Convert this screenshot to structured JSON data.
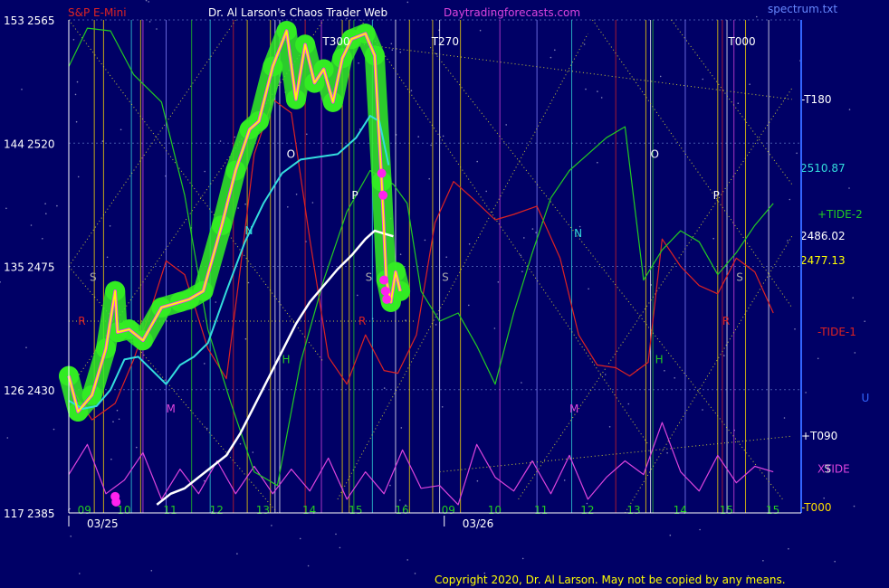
{
  "header": {
    "instrument": "S&P E-Mini",
    "title": "Dr. Al Larson's Chaos Trader Web",
    "site": "Daytradingforecasts.com",
    "spectrum": "spectrum.txt"
  },
  "copyright": "Copyright 2020, Dr. Al Larson. May not be copied by any means.",
  "colors": {
    "background": "#000066",
    "price": "#ffff00",
    "price_hl": "#ff33ff",
    "glow": "#33ee22",
    "ema_short": "#33dddd",
    "ema_long": "#ffffff",
    "tide_plus": "#22cc22",
    "tide_minus": "#dd2222",
    "xtide": "#dd44dd",
    "grid": "#555599"
  },
  "chart_data": {
    "type": "line",
    "title": "S&P E-Mini",
    "ylim": [
      2385,
      2565
    ],
    "y_ticks": [
      {
        "left": "153",
        "value": 2565
      },
      {
        "left": "144",
        "value": 2520
      },
      {
        "left": "135",
        "value": 2475
      },
      {
        "left": "126",
        "value": 2430
      },
      {
        "left": "117",
        "value": 2385
      }
    ],
    "x_hour_ticks": [
      {
        "label": "09",
        "t": 0.15
      },
      {
        "label": "10",
        "t": 1.0
      },
      {
        "label": "11",
        "t": 2.0
      },
      {
        "label": "12",
        "t": 3.0
      },
      {
        "label": "13",
        "t": 4.0
      },
      {
        "label": "14",
        "t": 5.0
      },
      {
        "label": "15",
        "t": 6.0
      },
      {
        "label": "16",
        "t": 7.0
      },
      {
        "label": "09",
        "t": 8.0
      },
      {
        "label": "10",
        "t": 9.0
      },
      {
        "label": "11",
        "t": 10.0
      },
      {
        "label": "12",
        "t": 11.0
      },
      {
        "label": "13",
        "t": 12.0
      },
      {
        "label": "14",
        "t": 13.0
      },
      {
        "label": "15",
        "t": 14.0
      },
      {
        "label": "15",
        "t": 15.0
      }
    ],
    "x_dates": [
      {
        "label": "03/25",
        "t": 0.0
      },
      {
        "label": "03/26",
        "t": 8.1
      }
    ],
    "series": [
      {
        "key": "price",
        "x": [
          0,
          0.2,
          0.5,
          0.8,
          1.0,
          1.05,
          1.3,
          1.6,
          2.0,
          2.4,
          2.6,
          2.9,
          3.3,
          3.6,
          3.9,
          4.1,
          4.4,
          4.7,
          4.9,
          5.1,
          5.3,
          5.5,
          5.7,
          5.9,
          6.1,
          6.4,
          6.6,
          6.75,
          6.85,
          6.95,
          7.05,
          7.15
        ],
        "y": [
          2435,
          2422,
          2428,
          2445,
          2466,
          2451,
          2452,
          2448,
          2460,
          2462,
          2463,
          2466,
          2490,
          2510,
          2525,
          2528,
          2548,
          2561,
          2536,
          2556,
          2542,
          2547,
          2535,
          2551,
          2558,
          2560,
          2552,
          2506,
          2470,
          2462,
          2473,
          2466
        ]
      },
      {
        "key": "ema_short",
        "x": [
          0,
          0.3,
          0.6,
          0.9,
          1.2,
          1.5,
          1.8,
          2.1,
          2.4,
          2.7,
          3.0,
          3.4,
          3.8,
          4.2,
          4.6,
          5.0,
          5.4,
          5.8,
          6.2,
          6.5,
          6.7,
          6.9
        ],
        "y": [
          2426,
          2423,
          2424,
          2430,
          2441,
          2442,
          2437,
          2432,
          2439,
          2442,
          2447,
          2466,
          2484,
          2498,
          2509,
          2514,
          2515,
          2516,
          2522,
          2530,
          2528,
          2512
        ]
      },
      {
        "key": "ema_long",
        "x": [
          1.9,
          2.2,
          2.5,
          2.8,
          3.1,
          3.4,
          3.7,
          4.0,
          4.3,
          4.6,
          4.9,
          5.2,
          5.5,
          5.8,
          6.1,
          6.4,
          6.6,
          6.8,
          7.0
        ],
        "y": [
          2388,
          2392,
          2394,
          2398,
          2402,
          2406,
          2414,
          2424,
          2434,
          2444,
          2454,
          2462,
          2468,
          2474,
          2479,
          2485,
          2488,
          2487,
          2486
        ]
      },
      {
        "key": "tide_plus",
        "x": [
          0,
          0.4,
          0.9,
          1.4,
          2.0,
          2.5,
          3.0,
          3.5,
          4.0,
          4.5,
          5.0,
          5.5,
          6.0,
          6.5,
          7.0,
          7.3,
          7.6,
          8.0,
          8.4,
          8.8,
          9.2,
          9.6,
          10.0,
          10.4,
          10.8,
          11.2,
          11.6,
          12.0,
          12.4,
          12.8,
          13.2,
          13.6,
          14.0,
          14.4,
          14.8,
          15.2
        ],
        "y": [
          2548,
          2562,
          2561,
          2545,
          2535,
          2501,
          2452,
          2425,
          2400,
          2395,
          2440,
          2470,
          2495,
          2510,
          2505,
          2498,
          2466,
          2455,
          2458,
          2446,
          2432,
          2458,
          2480,
          2500,
          2510,
          2516,
          2522,
          2526,
          2470,
          2481,
          2488,
          2484,
          2472,
          2480,
          2490,
          2498
        ]
      },
      {
        "key": "tide_minus",
        "x": [
          0,
          0.5,
          1.0,
          1.4,
          1.8,
          2.1,
          2.5,
          3.0,
          3.4,
          3.7,
          4.0,
          4.4,
          4.8,
          5.2,
          5.6,
          6.0,
          6.4,
          6.8,
          7.1,
          7.5,
          7.9,
          8.3,
          8.7,
          9.2,
          9.6,
          10.1,
          10.6,
          11.0,
          11.4,
          11.8,
          12.1,
          12.5,
          12.8,
          13.2,
          13.6,
          14.0,
          14.4,
          14.8,
          15.2
        ],
        "y": [
          2432,
          2419,
          2425,
          2441,
          2461,
          2477,
          2472,
          2445,
          2434,
          2474,
          2516,
          2536,
          2531,
          2485,
          2442,
          2432,
          2450,
          2437,
          2436,
          2450,
          2491,
          2506,
          2500,
          2492,
          2494,
          2497,
          2478,
          2450,
          2439,
          2438,
          2435,
          2440,
          2485,
          2475,
          2468,
          2465,
          2478,
          2473,
          2458
        ]
      },
      {
        "key": "xtide",
        "x": [
          0,
          0.4,
          0.8,
          1.2,
          1.6,
          2.0,
          2.4,
          2.8,
          3.2,
          3.6,
          4.0,
          4.4,
          4.8,
          5.2,
          5.6,
          6.0,
          6.4,
          6.8,
          7.2,
          7.6,
          8.0,
          8.4,
          8.8,
          9.2,
          9.6,
          10.0,
          10.4,
          10.8,
          11.2,
          11.6,
          12.0,
          12.4,
          12.8,
          13.2,
          13.6,
          14.0,
          14.4,
          14.8,
          15.2
        ],
        "y": [
          2399,
          2410,
          2392,
          2397,
          2407,
          2390,
          2401,
          2392,
          2404,
          2392,
          2402,
          2392,
          2401,
          2393,
          2405,
          2390,
          2400,
          2392,
          2408,
          2394,
          2395,
          2388,
          2410,
          2398,
          2393,
          2404,
          2392,
          2406,
          2390,
          2398,
          2404,
          2399,
          2418,
          2400,
          2393,
          2406,
          2396,
          2402,
          2400
        ]
      }
    ],
    "magenta_dots": [
      {
        "x": 1.0,
        "y": 2391
      },
      {
        "x": 1.02,
        "y": 2389
      },
      {
        "x": 6.75,
        "y": 2509
      },
      {
        "x": 6.78,
        "y": 2501
      },
      {
        "x": 6.8,
        "y": 2470
      },
      {
        "x": 6.83,
        "y": 2466
      },
      {
        "x": 6.86,
        "y": 2463
      }
    ],
    "series_labels": [
      {
        "label": "+TIDE-2",
        "value": 2494,
        "color": "#22cc22"
      },
      {
        "label": "-TIDE-1",
        "value": 2451,
        "color": "#dd2222"
      },
      {
        "label": "XTIDE",
        "value": 2401,
        "color": "#dd44dd"
      }
    ],
    "price_labels": [
      {
        "label": "2510.87",
        "value": 2510.87,
        "color": "#33dddd"
      },
      {
        "label": "2486.02",
        "value": 2486.02,
        "color": "#ffffff"
      },
      {
        "label": "2477.13",
        "value": 2477.13,
        "color": "#ffff00"
      }
    ],
    "time_markers": [
      {
        "label": "T300",
        "t": 5.75,
        "value": 2557
      },
      {
        "label": "T270",
        "t": 8.1,
        "value": 2557
      },
      {
        "label": "T000",
        "t": 14.5,
        "value": 2557
      },
      {
        "label": "-T180",
        "t": 15.6,
        "value": 2536
      },
      {
        "label": "+T090",
        "t": 15.6,
        "value": 2413
      },
      {
        "label": "-T000",
        "t": 15.6,
        "value": 2387
      }
    ],
    "planet_letters": [
      {
        "label": "S",
        "t": 0.45,
        "value": 2471,
        "color": "#aaaaaa"
      },
      {
        "label": "R",
        "t": 0.2,
        "value": 2455,
        "color": "#dd2222"
      },
      {
        "label": "M",
        "t": 2.1,
        "value": 2423,
        "color": "#dd44dd"
      },
      {
        "label": "N",
        "t": 3.8,
        "value": 2488,
        "color": "#33dddd"
      },
      {
        "label": "O",
        "t": 4.7,
        "value": 2516,
        "color": "#ffffff"
      },
      {
        "label": "H",
        "t": 4.6,
        "value": 2441,
        "color": "#22cc22"
      },
      {
        "label": "P",
        "t": 6.1,
        "value": 2501,
        "color": "#ffffff"
      },
      {
        "label": "S",
        "t": 6.4,
        "value": 2471,
        "color": "#aaaaaa"
      },
      {
        "label": "R",
        "t": 6.25,
        "value": 2455,
        "color": "#dd2222"
      },
      {
        "label": "S",
        "t": 8.05,
        "value": 2471,
        "color": "#aaaaaa"
      },
      {
        "label": "N",
        "t": 10.9,
        "value": 2487,
        "color": "#33dddd"
      },
      {
        "label": "M",
        "t": 10.8,
        "value": 2423,
        "color": "#dd44dd"
      },
      {
        "label": "O",
        "t": 12.55,
        "value": 2516,
        "color": "#ffffff"
      },
      {
        "label": "H",
        "t": 12.65,
        "value": 2441,
        "color": "#22cc22"
      },
      {
        "label": "P",
        "t": 13.9,
        "value": 2501,
        "color": "#ffffff"
      },
      {
        "label": "S",
        "t": 14.4,
        "value": 2471,
        "color": "#aaaaaa"
      },
      {
        "label": "R",
        "t": 14.1,
        "value": 2455,
        "color": "#dd2222"
      },
      {
        "label": "U",
        "t": 17.1,
        "value": 2427,
        "color": "#3366ff"
      },
      {
        "label": "S",
        "t": 16.3,
        "value": 2401,
        "color": "#dddddd"
      }
    ],
    "vertical_lines": [
      {
        "t": 0.0,
        "color": "#ffffff"
      },
      {
        "t": 0.55,
        "color": "#ffdd00"
      },
      {
        "t": 0.75,
        "color": "#ffdd00"
      },
      {
        "t": 1.35,
        "color": "#33dddd"
      },
      {
        "t": 1.55,
        "color": "#ffdd00"
      },
      {
        "t": 1.6,
        "color": "#dd44dd"
      },
      {
        "t": 2.1,
        "color": "#8888ff"
      },
      {
        "t": 2.65,
        "color": "#22cc22"
      },
      {
        "t": 3.05,
        "color": "#33dddd"
      },
      {
        "t": 3.55,
        "color": "#dd2222"
      },
      {
        "t": 3.85,
        "color": "#ffdd00"
      },
      {
        "t": 4.35,
        "color": "#ffdd00"
      },
      {
        "t": 4.45,
        "color": "#ffffff"
      },
      {
        "t": 4.55,
        "color": "#ffffff"
      },
      {
        "t": 5.1,
        "color": "#dd2222"
      },
      {
        "t": 5.45,
        "color": "#dd44dd"
      },
      {
        "t": 5.9,
        "color": "#ffdd00"
      },
      {
        "t": 6.05,
        "color": "#ffdd00"
      },
      {
        "t": 6.15,
        "color": "#22cc22"
      },
      {
        "t": 6.55,
        "color": "#33dddd"
      },
      {
        "t": 7.05,
        "color": "#ffffff"
      },
      {
        "t": 7.35,
        "color": "#ffdd00"
      },
      {
        "t": 7.85,
        "color": "#ffdd00"
      },
      {
        "t": 8.0,
        "color": "#ffffff"
      },
      {
        "t": 8.45,
        "color": "#ffdd00"
      },
      {
        "t": 9.3,
        "color": "#dd44dd"
      },
      {
        "t": 10.1,
        "color": "#8888ff"
      },
      {
        "t": 10.85,
        "color": "#33dddd"
      },
      {
        "t": 11.8,
        "color": "#dd2222"
      },
      {
        "t": 12.45,
        "color": "#ffdd00"
      },
      {
        "t": 12.55,
        "color": "#ffffff"
      },
      {
        "t": 12.6,
        "color": "#22cc22"
      },
      {
        "t": 13.3,
        "color": "#8888ff"
      },
      {
        "t": 14.0,
        "color": "#ffdd00"
      },
      {
        "t": 14.1,
        "color": "#dd2222"
      },
      {
        "t": 14.2,
        "color": "#ffffff"
      },
      {
        "t": 14.35,
        "color": "#dd44dd"
      },
      {
        "t": 14.6,
        "color": "#ffdd00"
      },
      {
        "t": 15.1,
        "color": "#ffffff"
      }
    ],
    "diagonal_lines": [
      {
        "t1": 0,
        "y1": 2565,
        "t2": 5.5,
        "y2": 2440
      },
      {
        "t1": 0,
        "y1": 2475,
        "t2": 3.6,
        "y2": 2565
      },
      {
        "t1": 0,
        "y1": 2475,
        "t2": 4.5,
        "y2": 2385
      },
      {
        "t1": 0,
        "y1": 2430,
        "t2": 5.5,
        "y2": 2565
      },
      {
        "t1": 5.9,
        "y1": 2557,
        "t2": 15.6,
        "y2": 2536
      },
      {
        "t1": 7.8,
        "y1": 2555,
        "t2": 15.4,
        "y2": 2390
      },
      {
        "t1": 8.0,
        "y1": 2400,
        "t2": 15.6,
        "y2": 2413
      },
      {
        "t1": 5.8,
        "y1": 2390,
        "t2": 11.2,
        "y2": 2560
      },
      {
        "t1": 6.3,
        "y1": 2565,
        "t2": 12.5,
        "y2": 2410
      },
      {
        "t1": 9.7,
        "y1": 2390,
        "t2": 15.6,
        "y2": 2540
      },
      {
        "t1": 11.3,
        "y1": 2565,
        "t2": 15.6,
        "y2": 2460
      },
      {
        "t1": 12.0,
        "y1": 2385,
        "t2": 15.6,
        "y2": 2486
      },
      {
        "t1": 13.0,
        "y1": 2565,
        "t2": 15.6,
        "y2": 2505
      },
      {
        "t1": 0,
        "y1": 2455,
        "t2": 7.5,
        "y2": 2455
      }
    ],
    "grid": true,
    "legend": "right-side labels"
  }
}
